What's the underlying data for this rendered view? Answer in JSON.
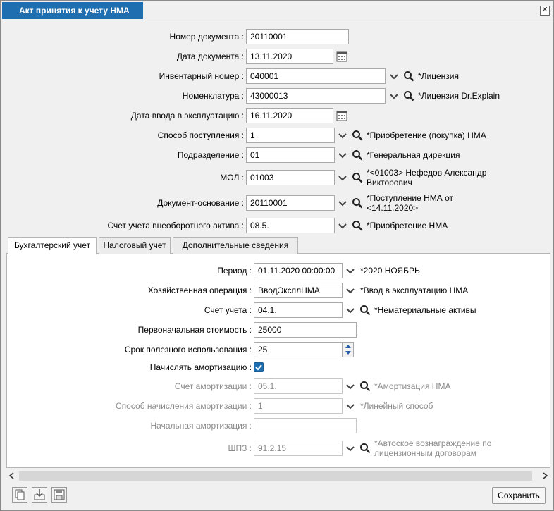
{
  "window": {
    "title": "Акт принятия к учету НМА"
  },
  "fields": {
    "doc_number": {
      "label": "Номер документа :",
      "value": "20110001"
    },
    "doc_date": {
      "label": "Дата документа :",
      "value": "13.11.2020"
    },
    "inventory_number": {
      "label": "Инвентарный номер :",
      "value": "040001",
      "desc": "*Лицензия"
    },
    "nomenclature": {
      "label": "Номенклатура :",
      "value": "43000013",
      "desc": "*Лицензия Dr.Explain"
    },
    "commissioning_date": {
      "label": "Дата ввода в эксплуатацию :",
      "value": "16.11.2020"
    },
    "receipt_method": {
      "label": "Способ поступления :",
      "value": "1",
      "desc": "*Приобретение (покупка) НМА"
    },
    "department": {
      "label": "Подразделение :",
      "value": "01",
      "desc": "*Генеральная дирекция"
    },
    "mol": {
      "label": "МОЛ :",
      "value": "01003",
      "desc_line1": "*<01003> Нефедов Александр",
      "desc_line2": "Викторович"
    },
    "base_document": {
      "label": "Документ-основание :",
      "value": "20110001",
      "desc_line1": "*Поступление НМА от",
      "desc_line2": "<14.11.2020>"
    },
    "noncurrent_account": {
      "label": "Счет учета внеоборотного актива :",
      "value": "08.5.",
      "desc": "*Приобретение НМА"
    }
  },
  "tabs": [
    {
      "label": "Бухгалтерский учет",
      "active": true
    },
    {
      "label": "Налоговый учет",
      "active": false
    },
    {
      "label": "Дополнительные сведения",
      "active": false
    }
  ],
  "accounting": {
    "period": {
      "label": "Период :",
      "value": "01.11.2020 00:00:00",
      "desc": "*2020 НОЯБРЬ"
    },
    "operation": {
      "label": "Хозяйственная операция :",
      "value": "ВводЭксплНМА",
      "desc": "*Ввод в эксплуатацию НМА"
    },
    "account": {
      "label": "Счет учета :",
      "value": "04.1.",
      "desc": "*Нематериальные активы"
    },
    "initial_cost": {
      "label": "Первоначальная стоимость :",
      "value": "25000"
    },
    "useful_life": {
      "label": "Срок полезного использования :",
      "value": "25"
    },
    "accrue_depreciation": {
      "label": "Начислять амортизацию :",
      "checked": true
    },
    "depreciation_account": {
      "label": "Счет амортизации :",
      "value": "05.1.",
      "desc": "*Амортизация НМА"
    },
    "depreciation_method": {
      "label": "Способ начисления амортизации :",
      "value": "1",
      "desc": "*Линейный способ"
    },
    "initial_depreciation": {
      "label": "Начальная амортизация :",
      "value": ""
    },
    "shpz": {
      "label": "ШПЗ :",
      "value": "91.2.15",
      "desc_line1": "*Автоское вознаграждение по",
      "desc_line2": "лицензионным договорам"
    }
  },
  "buttons": {
    "save": "Сохранить"
  },
  "colors": {
    "accent": "#1f6fb0",
    "disabled_text": "#8c8c8c"
  }
}
